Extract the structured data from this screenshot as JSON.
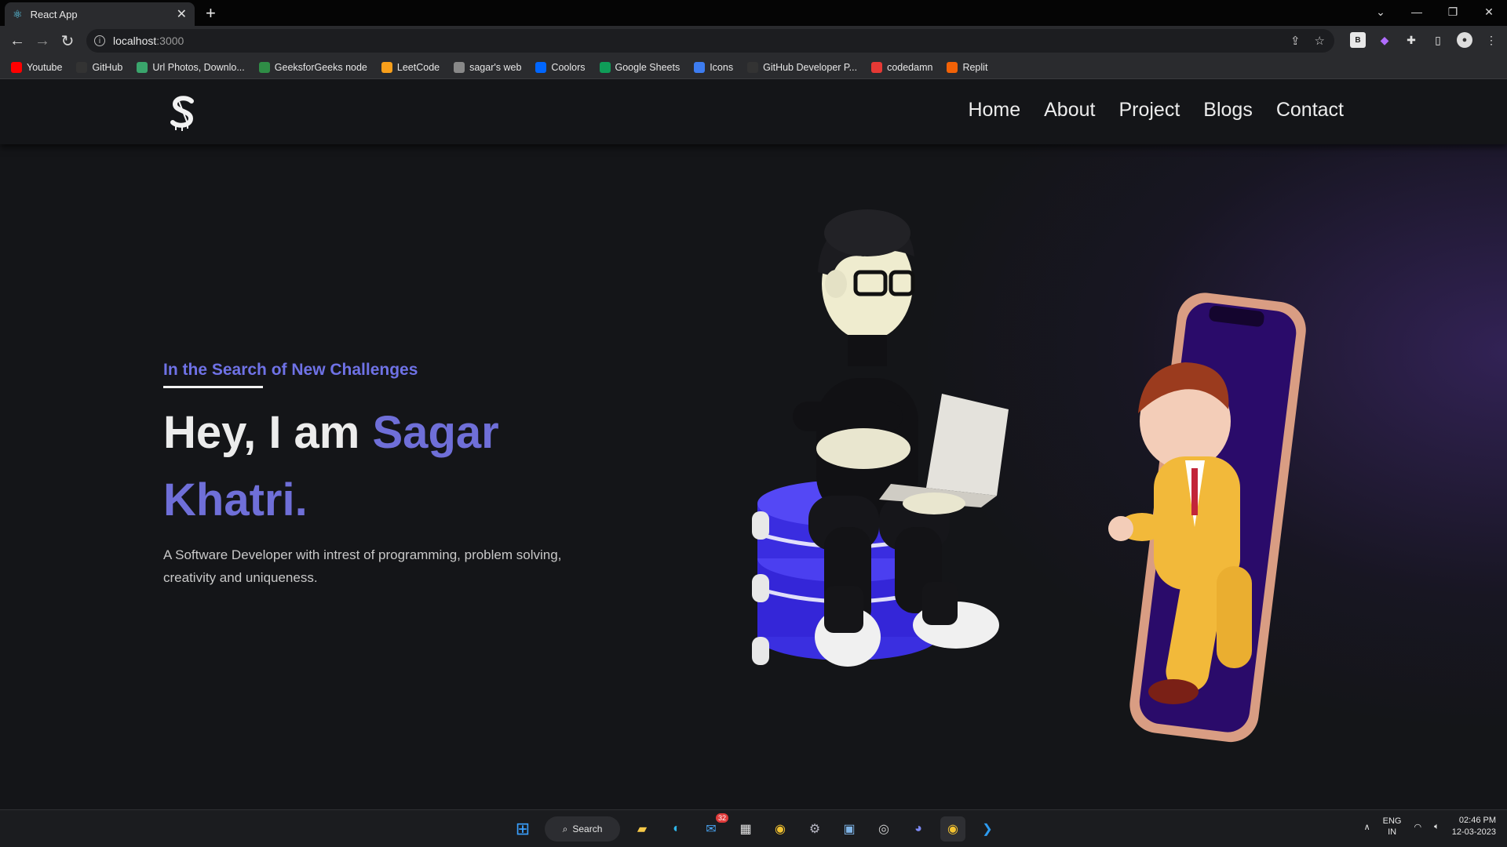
{
  "browser": {
    "tab_title": "React App",
    "url_host": "localhost",
    "url_port": ":3000",
    "bookmarks": [
      {
        "label": "Youtube",
        "icon": "youtube-icon",
        "color": "#ff0000"
      },
      {
        "label": "GitHub",
        "icon": "github-icon",
        "color": "#333333"
      },
      {
        "label": "Url Photos, Downlo...",
        "icon": "image-icon",
        "color": "#3aa56c"
      },
      {
        "label": "GeeksforGeeks node",
        "icon": "gfg-icon",
        "color": "#2f8d46"
      },
      {
        "label": "LeetCode",
        "icon": "leetcode-icon",
        "color": "#f89f1b"
      },
      {
        "label": "sagar's web",
        "icon": "globe-icon",
        "color": "#888888"
      },
      {
        "label": "Coolors",
        "icon": "coolors-icon",
        "color": "#0066ff"
      },
      {
        "label": "Google Sheets",
        "icon": "sheets-icon",
        "color": "#0f9d58"
      },
      {
        "label": "Icons",
        "icon": "flag-icon",
        "color": "#3d7cf0"
      },
      {
        "label": "GitHub Developer P...",
        "icon": "github-icon",
        "color": "#333333"
      },
      {
        "label": "codedamn",
        "icon": "codedamn-icon",
        "color": "#e53935"
      },
      {
        "label": "Replit",
        "icon": "replit-icon",
        "color": "#f26207"
      }
    ]
  },
  "site": {
    "nav": [
      "Home",
      "About",
      "Project",
      "Blogs",
      "Contact"
    ],
    "tagline": "In the Search of New Challenges",
    "heading_prefix": "Hey, I am ",
    "heading_name": "Sagar Khatri.",
    "description": "A Software Developer with intrest of programming, problem solving, creativity and uniqueness.",
    "accent_color": "#6f72e6"
  },
  "taskbar": {
    "search_label": "Search",
    "mail_badge": "32",
    "lang_line1": "ENG",
    "lang_line2": "IN",
    "time": "02:46 PM",
    "date": "12-03-2023"
  }
}
